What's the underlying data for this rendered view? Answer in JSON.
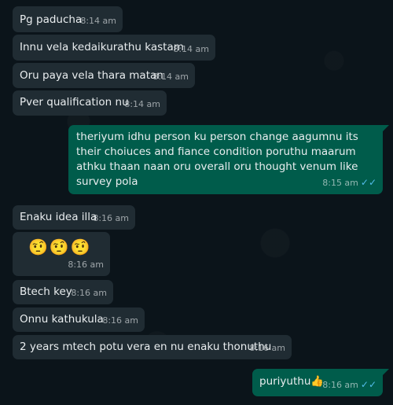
{
  "messages": [
    {
      "dir": "in",
      "text": "Pg paducha",
      "time": "8:14 am"
    },
    {
      "dir": "in",
      "text": "Innu vela kedaikurathu kastam",
      "time": "8:14 am"
    },
    {
      "dir": "in",
      "text": "Oru paya vela thara matan",
      "time": "8:14 am"
    },
    {
      "dir": "in",
      "text": "Pver qualification nu",
      "time": "8:14 am"
    },
    {
      "dir": "out",
      "text": "theriyum idhu person ku person change aagumnu its their choiuces and fiance condition poruthu maarum athku thaan naan oru overall oru thought venum like survey pola",
      "time": "8:15 am",
      "ticks": "✓✓"
    },
    {
      "dir": "in",
      "text": "Enaku idea illa",
      "time": "8:16 am"
    },
    {
      "dir": "in",
      "text": "🤨🤨🤨",
      "time": "8:16 am"
    },
    {
      "dir": "in",
      "text": "Btech key",
      "time": "8:16 am"
    },
    {
      "dir": "in",
      "text": "Onnu kathukula",
      "time": "8:16 am"
    },
    {
      "dir": "in",
      "text": "2 years mtech potu vera en nu enaku thonuthu",
      "time": "8:16 am"
    },
    {
      "dir": "out",
      "text": "puriyuthu👍",
      "time": "8:16 am",
      "ticks": "✓✓"
    }
  ]
}
